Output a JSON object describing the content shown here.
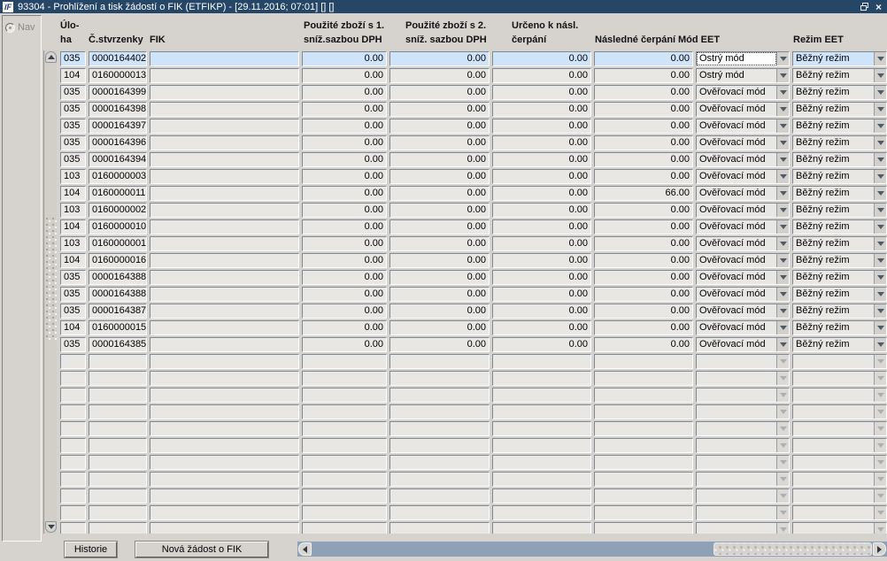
{
  "window": {
    "title": "93304 - Prohlížení a tisk žádostí o FIK (ETFIKP) - [29.11.2016; 07:01]  []  []",
    "app_icon_glyph": "ĭF",
    "close_glyph": "×"
  },
  "colors": {
    "titlebar": "#264668",
    "client_background": "#d6d3ce",
    "cell_background": "#e9e7e3",
    "selected_row_background": "#cfe3f9",
    "hscroll_track": "#8fa1b6"
  },
  "sidebar": {
    "nav_label": "Nav"
  },
  "table": {
    "headers": [
      "Úlo-\nha",
      "Č.stvrzenky",
      "FIK",
      "Použité zboží s 1.\nsníž.sazbou DPH",
      "Použité zboží s 2.\nsníž. sazbou DPH",
      "Určeno k násl.\nčerpání",
      "Následné čerpání",
      "Mód EET",
      "Režim EET"
    ],
    "rows": [
      {
        "uloha": "035",
        "stvrzenka": "0000164402",
        "fik": "",
        "zbozi1": "0.00",
        "zbozi2": "0.00",
        "urceno": "0.00",
        "nasledne": "0.00",
        "mod": "Ostrý mód",
        "rezim": "Běžný režim",
        "selected": true,
        "focused": true
      },
      {
        "uloha": "104",
        "stvrzenka": "0160000013",
        "fik": "",
        "zbozi1": "0.00",
        "zbozi2": "0.00",
        "urceno": "0.00",
        "nasledne": "0.00",
        "mod": "Ostrý mód",
        "rezim": "Běžný režim"
      },
      {
        "uloha": "035",
        "stvrzenka": "0000164399",
        "fik": "",
        "zbozi1": "0.00",
        "zbozi2": "0.00",
        "urceno": "0.00",
        "nasledne": "0.00",
        "mod": "Ověřovací mód",
        "rezim": "Běžný režim"
      },
      {
        "uloha": "035",
        "stvrzenka": "0000164398",
        "fik": "",
        "zbozi1": "0.00",
        "zbozi2": "0.00",
        "urceno": "0.00",
        "nasledne": "0.00",
        "mod": "Ověřovací mód",
        "rezim": "Běžný režim"
      },
      {
        "uloha": "035",
        "stvrzenka": "0000164397",
        "fik": "",
        "zbozi1": "0.00",
        "zbozi2": "0.00",
        "urceno": "0.00",
        "nasledne": "0.00",
        "mod": "Ověřovací mód",
        "rezim": "Běžný režim"
      },
      {
        "uloha": "035",
        "stvrzenka": "0000164396",
        "fik": "",
        "zbozi1": "0.00",
        "zbozi2": "0.00",
        "urceno": "0.00",
        "nasledne": "0.00",
        "mod": "Ověřovací mód",
        "rezim": "Běžný režim"
      },
      {
        "uloha": "035",
        "stvrzenka": "0000164394",
        "fik": "",
        "zbozi1": "0.00",
        "zbozi2": "0.00",
        "urceno": "0.00",
        "nasledne": "0.00",
        "mod": "Ověřovací mód",
        "rezim": "Běžný režim"
      },
      {
        "uloha": "103",
        "stvrzenka": "0160000003",
        "fik": "",
        "zbozi1": "0.00",
        "zbozi2": "0.00",
        "urceno": "0.00",
        "nasledne": "0.00",
        "mod": "Ověřovací mód",
        "rezim": "Běžný režim"
      },
      {
        "uloha": "104",
        "stvrzenka": "0160000011",
        "fik": "",
        "zbozi1": "0.00",
        "zbozi2": "0.00",
        "urceno": "0.00",
        "nasledne": "66.00",
        "mod": "Ověřovací mód",
        "rezim": "Běžný režim"
      },
      {
        "uloha": "103",
        "stvrzenka": "0160000002",
        "fik": "",
        "zbozi1": "0.00",
        "zbozi2": "0.00",
        "urceno": "0.00",
        "nasledne": "0.00",
        "mod": "Ověřovací mód",
        "rezim": "Běžný režim"
      },
      {
        "uloha": "104",
        "stvrzenka": "0160000010",
        "fik": "",
        "zbozi1": "0.00",
        "zbozi2": "0.00",
        "urceno": "0.00",
        "nasledne": "0.00",
        "mod": "Ověřovací mód",
        "rezim": "Běžný režim"
      },
      {
        "uloha": "103",
        "stvrzenka": "0160000001",
        "fik": "",
        "zbozi1": "0.00",
        "zbozi2": "0.00",
        "urceno": "0.00",
        "nasledne": "0.00",
        "mod": "Ověřovací mód",
        "rezim": "Běžný režim"
      },
      {
        "uloha": "104",
        "stvrzenka": "0160000016",
        "fik": "",
        "zbozi1": "0.00",
        "zbozi2": "0.00",
        "urceno": "0.00",
        "nasledne": "0.00",
        "mod": "Ověřovací mód",
        "rezim": "Běžný režim"
      },
      {
        "uloha": "035",
        "stvrzenka": "0000164388",
        "fik": "",
        "zbozi1": "0.00",
        "zbozi2": "0.00",
        "urceno": "0.00",
        "nasledne": "0.00",
        "mod": "Ověřovací mód",
        "rezim": "Běžný režim"
      },
      {
        "uloha": "035",
        "stvrzenka": "0000164388",
        "fik": "",
        "zbozi1": "0.00",
        "zbozi2": "0.00",
        "urceno": "0.00",
        "nasledne": "0.00",
        "mod": "Ověřovací mód",
        "rezim": "Běžný režim"
      },
      {
        "uloha": "035",
        "stvrzenka": "0000164387",
        "fik": "",
        "zbozi1": "0.00",
        "zbozi2": "0.00",
        "urceno": "0.00",
        "nasledne": "0.00",
        "mod": "Ověřovací mód",
        "rezim": "Běžný režim"
      },
      {
        "uloha": "104",
        "stvrzenka": "0160000015",
        "fik": "",
        "zbozi1": "0.00",
        "zbozi2": "0.00",
        "urceno": "0.00",
        "nasledne": "0.00",
        "mod": "Ověřovací mód",
        "rezim": "Běžný režim"
      },
      {
        "uloha": "035",
        "stvrzenka": "0000164385",
        "fik": "",
        "zbozi1": "0.00",
        "zbozi2": "0.00",
        "urceno": "0.00",
        "nasledne": "0.00",
        "mod": "Ověřovací mód",
        "rezim": "Běžný režim"
      }
    ],
    "empty_row_count": 11
  },
  "footer": {
    "historie_button": "Historie",
    "nova_zadost_button": "Nová žádost o FIK"
  }
}
